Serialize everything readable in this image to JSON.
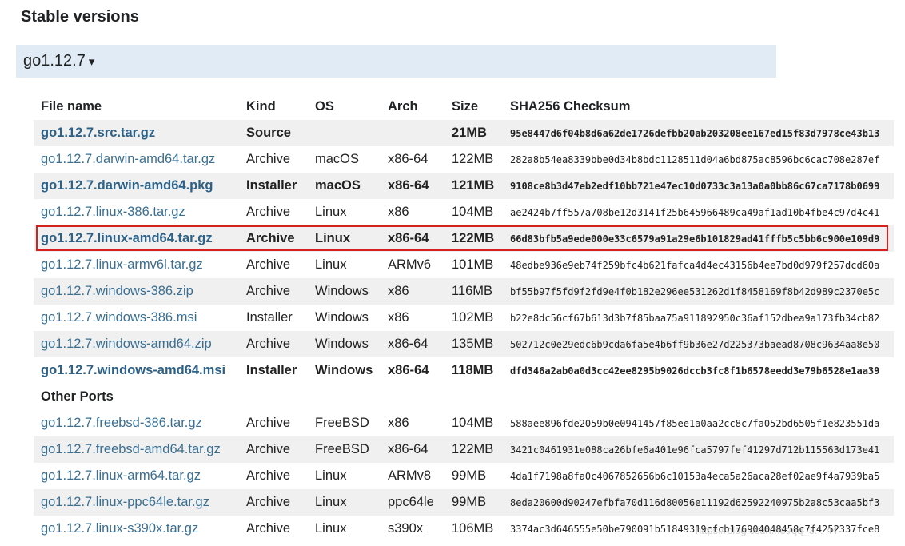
{
  "section": {
    "title": "Stable versions"
  },
  "version": {
    "label": "go1.12.7",
    "caret": "▾"
  },
  "table": {
    "headers": [
      "File name",
      "Kind",
      "OS",
      "Arch",
      "Size",
      "SHA256 Checksum"
    ],
    "rows": [
      {
        "file": "go1.12.7.src.tar.gz",
        "kind": "Source",
        "os": "",
        "arch": "",
        "size": "21MB",
        "sha": "95e8447d6f04b8d6a62de1726defbb20ab203208ee167ed15f83d7978ce43b13",
        "highlight": true,
        "shade": true
      },
      {
        "file": "go1.12.7.darwin-amd64.tar.gz",
        "kind": "Archive",
        "os": "macOS",
        "arch": "x86-64",
        "size": "122MB",
        "sha": "282a8b54ea8339bbe0d34b8bdc1128511d04a6bd875ac8596bc6cac708e287ef",
        "highlight": false,
        "shade": false
      },
      {
        "file": "go1.12.7.darwin-amd64.pkg",
        "kind": "Installer",
        "os": "macOS",
        "arch": "x86-64",
        "size": "121MB",
        "sha": "9108ce8b3d47eb2edf10bb721e47ec10d0733c3a13a0a0bb86c67ca7178b0699",
        "highlight": true,
        "shade": true
      },
      {
        "file": "go1.12.7.linux-386.tar.gz",
        "kind": "Archive",
        "os": "Linux",
        "arch": "x86",
        "size": "104MB",
        "sha": "ae2424b7ff557a708be12d3141f25b645966489ca49af1ad10b4fbe4c97d4c41",
        "highlight": false,
        "shade": false
      },
      {
        "file": "go1.12.7.linux-amd64.tar.gz",
        "kind": "Archive",
        "os": "Linux",
        "arch": "x86-64",
        "size": "122MB",
        "sha": "66d83bfb5a9ede000e33c6579a91a29e6b101829ad41fffb5c5bb6c900e109d9",
        "highlight": true,
        "shade": true
      },
      {
        "file": "go1.12.7.linux-armv6l.tar.gz",
        "kind": "Archive",
        "os": "Linux",
        "arch": "ARMv6",
        "size": "101MB",
        "sha": "48edbe936e9eb74f259bfc4b621fafca4d4ec43156b4ee7bd0d979f257dcd60a",
        "highlight": false,
        "shade": false
      },
      {
        "file": "go1.12.7.windows-386.zip",
        "kind": "Archive",
        "os": "Windows",
        "arch": "x86",
        "size": "116MB",
        "sha": "bf55b97f5fd9f2fd9e4f0b182e296ee531262d1f8458169f8b42d989c2370e5c",
        "highlight": false,
        "shade": true
      },
      {
        "file": "go1.12.7.windows-386.msi",
        "kind": "Installer",
        "os": "Windows",
        "arch": "x86",
        "size": "102MB",
        "sha": "b22e8dc56cf67b613d3b7f85baa75a911892950c36af152dbea9a173fb34cb82",
        "highlight": false,
        "shade": false
      },
      {
        "file": "go1.12.7.windows-amd64.zip",
        "kind": "Archive",
        "os": "Windows",
        "arch": "x86-64",
        "size": "135MB",
        "sha": "502712c0e29edc6b9cda6fa5e4b6ff9b36e27d225373baead8708c9634aa8e50",
        "highlight": false,
        "shade": true
      },
      {
        "file": "go1.12.7.windows-amd64.msi",
        "kind": "Installer",
        "os": "Windows",
        "arch": "x86-64",
        "size": "118MB",
        "sha": "dfd346a2ab0a0d3cc42ee8295b9026dccb3fc8f1b6578eedd3e79b6528e1aa39",
        "highlight": true,
        "shade": false
      }
    ],
    "other_ports_label": "Other Ports",
    "port_rows": [
      {
        "file": "go1.12.7.freebsd-386.tar.gz",
        "kind": "Archive",
        "os": "FreeBSD",
        "arch": "x86",
        "size": "104MB",
        "sha": "588aee896fde2059b0e0941457f85ee1a0aa2cc8c7fa052bd6505f1e823551da",
        "shade": false
      },
      {
        "file": "go1.12.7.freebsd-amd64.tar.gz",
        "kind": "Archive",
        "os": "FreeBSD",
        "arch": "x86-64",
        "size": "122MB",
        "sha": "3421c0461931e088ca26bfe6a401e96fca5797fef41297d712b115563d173e41",
        "shade": true
      },
      {
        "file": "go1.12.7.linux-arm64.tar.gz",
        "kind": "Archive",
        "os": "Linux",
        "arch": "ARMv8",
        "size": "99MB",
        "sha": "4da1f7198a8fa0c4067852656b6c10153a4eca5a26aca28ef02ae9f4a7939ba5",
        "shade": false
      },
      {
        "file": "go1.12.7.linux-ppc64le.tar.gz",
        "kind": "Archive",
        "os": "Linux",
        "arch": "ppc64le",
        "size": "99MB",
        "sha": "8eda20600d90247efbfa70d116d80056e11192d62592240975b2a8c53caa5bf3",
        "shade": true
      },
      {
        "file": "go1.12.7.linux-s390x.tar.gz",
        "kind": "Archive",
        "os": "Linux",
        "arch": "s390x",
        "size": "106MB",
        "sha": "3374ac3d646555e50be790091b51849319cfcb176904048458c7f4252337fce8",
        "shade": false
      }
    ]
  },
  "watermark": "https://blog.csdn.net/qq_3... 44",
  "colors": {
    "link": "#3a6f91",
    "toggle_bg": "#e0ebf5",
    "row_shade": "#f0f0f0",
    "highlight_box": "#d61f1f"
  }
}
